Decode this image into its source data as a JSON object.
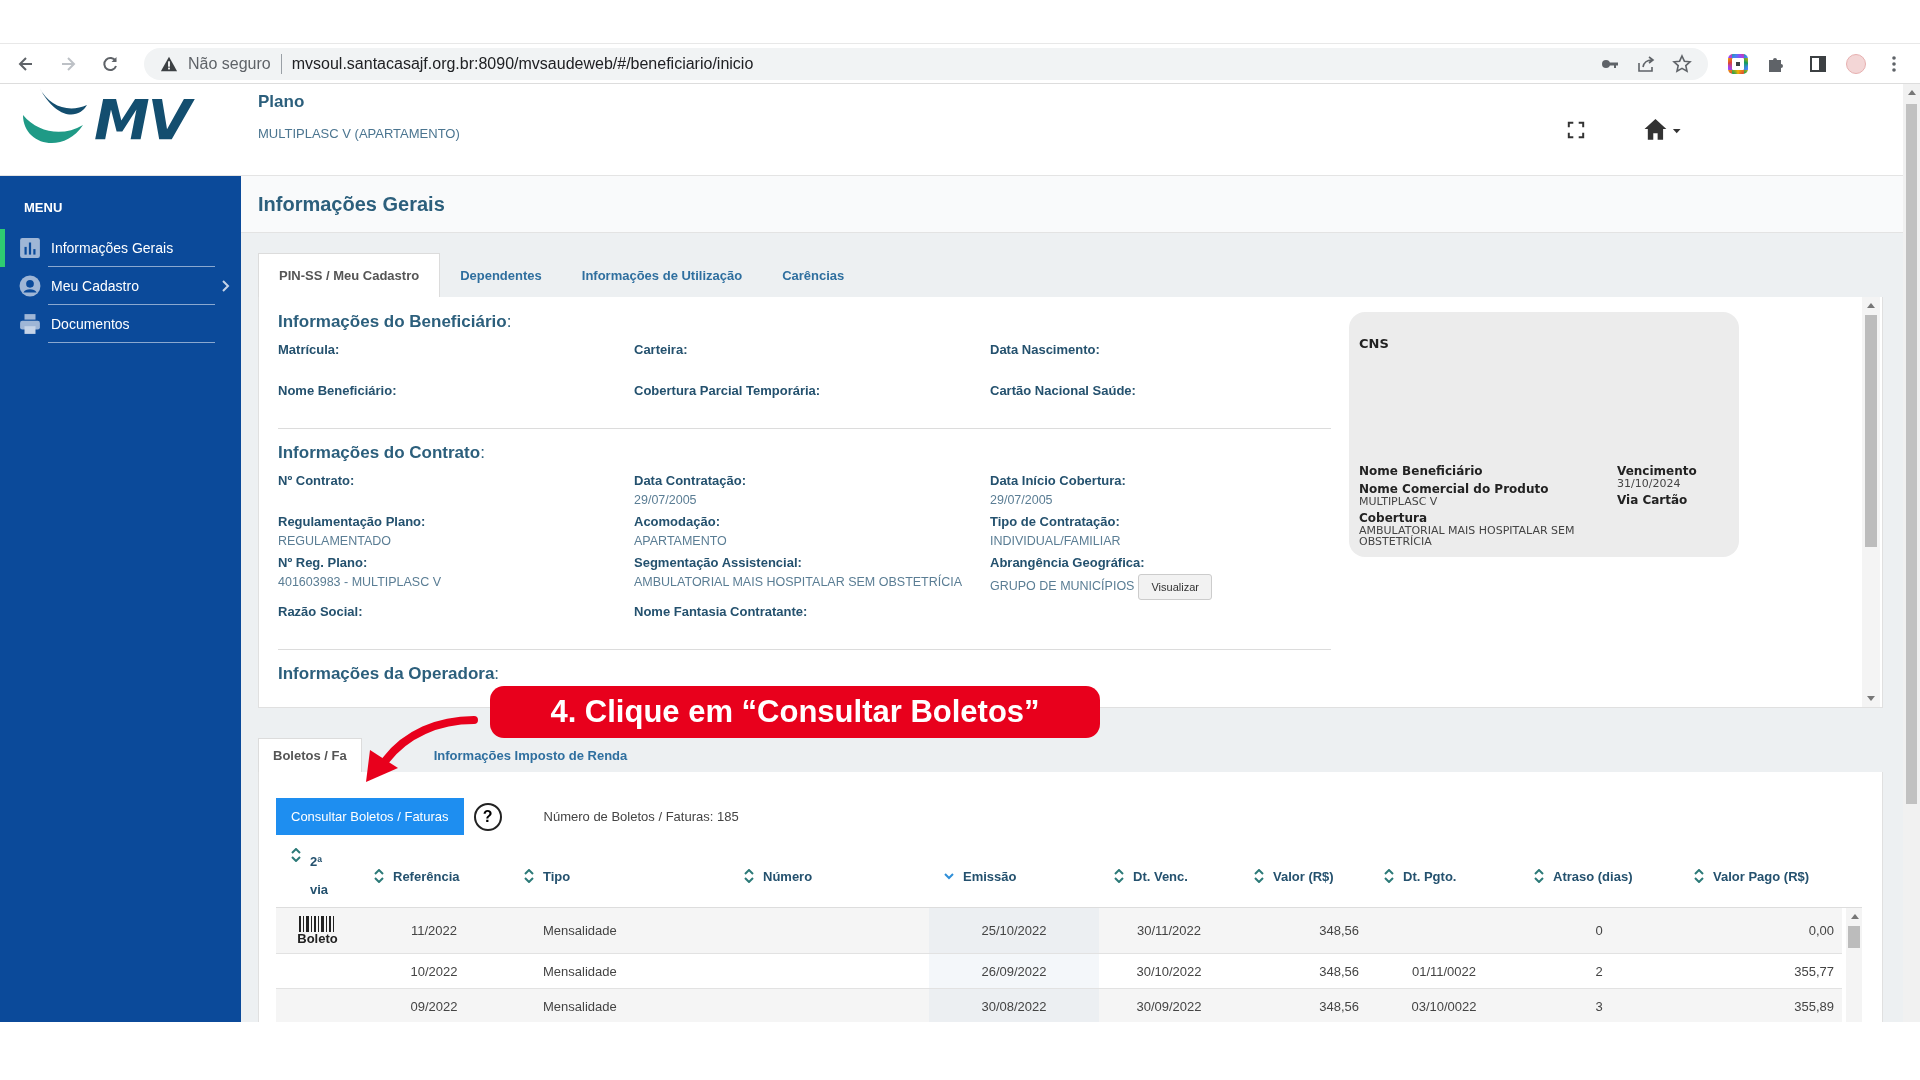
{
  "browser": {
    "security": "Não seguro",
    "url": "mvsoul.santacasajf.org.br:8090/mvsaudeweb/#/beneficiario/inicio",
    "forward_disabled": true
  },
  "header": {
    "logo": "MV",
    "plan_label": "Plano",
    "plan_name": "MULTIPLASC V (APARTAMENTO)"
  },
  "sidebar": {
    "title": "MENU",
    "items": [
      {
        "label": "Informações Gerais",
        "selected": true,
        "has_submenu": false
      },
      {
        "label": "Meu Cadastro",
        "selected": false,
        "has_submenu": true
      },
      {
        "label": "Documentos",
        "selected": false,
        "has_submenu": false
      }
    ]
  },
  "page_title": "Informações Gerais",
  "tabs": [
    {
      "label": "PIN-SS / Meu Cadastro",
      "selected": true
    },
    {
      "label": "Dependentes",
      "selected": false
    },
    {
      "label": "Informações de Utilização",
      "selected": false
    },
    {
      "label": "Carências",
      "selected": false
    }
  ],
  "sections": [
    {
      "title": "**Informações do Beneficiário**:",
      "fields": [
        {
          "label": "Matrícula:"
        },
        {
          "label": "Carteira:"
        },
        {
          "label": "Data Nascimento:"
        },
        {
          "label": "Nome Beneficiário:"
        },
        {
          "label": "Cobertura Parcial Temporária:"
        },
        {
          "label": "Cartão Nacional Saúde:"
        }
      ]
    },
    {
      "title": "**Informações do Contrato**:",
      "fields": [
        {
          "label": "Nº Contrato:"
        },
        {
          "label": "Data Contratação:",
          "value": "29/07/2005"
        },
        {
          "label": "Data Início Cobertura:",
          "value": "29/07/2005"
        },
        {
          "label": "Regulamentação Plano:",
          "value": "REGULAMENTADO"
        },
        {
          "label": "Acomodação:",
          "value": "APARTAMENTO"
        },
        {
          "label": "Tipo de Contratação:",
          "value": "INDIVIDUAL/FAMILIAR"
        },
        {
          "label": "Nº Reg. Plano:",
          "value": "401603983 - MULTIPLASC V"
        },
        {
          "label": "Segmentação Assistencial:",
          "value": "AMBULATORIAL MAIS HOSPITALAR SEM OBSTETRÍCIA"
        },
        {
          "label": "Abrangência Geográfica:",
          "value": "GRUPO DE MUNICÍPIOS",
          "button": "Visualizar"
        },
        {
          "label": "Razão Social:"
        },
        {
          "label": "Nome Fantasia Contratante:"
        }
      ]
    },
    {
      "title": "**Informações da Operadora**:"
    }
  ],
  "card": {
    "title": "CNS",
    "left": [
      {
        "label": "Nome Beneficiário"
      },
      {
        "label": "Nome Comercial do Produto",
        "value": "MULTIPLASC V"
      },
      {
        "label": "Cobertura",
        "value": "AMBULATORIAL MAIS HOSPITALAR SEM OBSTETRÍCIA"
      }
    ],
    "right": [
      {
        "label": "Vencimento",
        "value": "31/10/2024"
      },
      {
        "label": "Via Cartão"
      }
    ]
  },
  "lower_tabs": [
    {
      "label": "Boletos / Fa",
      "selected": true
    },
    {
      "label": "Informações Imposto de Renda",
      "selected": false
    }
  ],
  "consult_button": "Consultar Boletos / Faturas",
  "help": "?",
  "count": "Número de Boletos / Faturas: 185",
  "table": {
    "columns": [
      {
        "label": "2ª via",
        "sorted": false
      },
      {
        "label": "Referência",
        "sorted": false
      },
      {
        "label": "Tipo",
        "sorted": false
      },
      {
        "label": "Número",
        "sorted": false
      },
      {
        "label": "Emissão",
        "sorted": true
      },
      {
        "label": "Dt. Venc.",
        "sorted": false
      },
      {
        "label": "Valor (R$)",
        "sorted": false
      },
      {
        "label": "Dt. Pgto.",
        "sorted": false
      },
      {
        "label": "Atraso (dias)",
        "sorted": false
      },
      {
        "label": "Valor Pago (R$)",
        "sorted": false
      }
    ],
    "rows": [
      {
        "cells": [
          "Boleto",
          "11/2022",
          "Mensalidade",
          null,
          "25/10/2022",
          "30/11/2022",
          "348,56",
          null,
          "0",
          "0,00"
        ]
      },
      {
        "cells": [
          null,
          "10/2022",
          "Mensalidade",
          null,
          "26/09/2022",
          "30/10/2022",
          "348,56",
          "01/11/0022",
          "2",
          "355,77"
        ]
      },
      {
        "cells": [
          null,
          "09/2022",
          "Mensalidade",
          null,
          "30/08/2022",
          "30/09/2022",
          "348,56",
          "03/10/0022",
          "3",
          "355,89"
        ]
      }
    ]
  },
  "annotation": {
    "text": "4. Clique em “Consultar Boletos”"
  }
}
